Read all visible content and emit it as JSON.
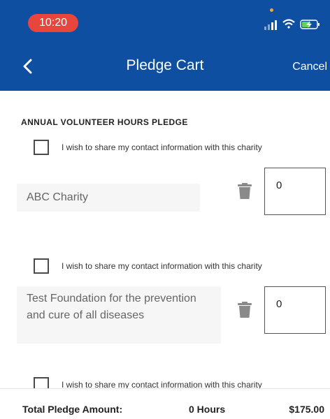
{
  "status_bar": {
    "time": "10:20",
    "icons": [
      "signal-icon",
      "wifi-icon",
      "battery-charging-icon"
    ]
  },
  "nav": {
    "back_icon": "chevron-left-icon",
    "title": "Pledge Cart",
    "cancel_label": "Cancel"
  },
  "section": {
    "title": "ANNUAL VOLUNTEER HOURS PLEDGE"
  },
  "items": [
    {
      "share_label": "I wish to share my contact information with this charity",
      "charity_name": "ABC Charity",
      "hours": "0"
    },
    {
      "share_label": "I wish to share my contact information with this charity",
      "charity_name": "Test Foundation for the prevention and cure of all diseases",
      "hours": "0"
    },
    {
      "share_label": "I wish to share my contact information with this charity"
    }
  ],
  "footer": {
    "total_label": "Total Pledge Amount:",
    "total_hours": "0 Hours",
    "total_amount": "$175.00"
  },
  "colors": {
    "header": "#0f4fa1",
    "time_pill": "#e8463d",
    "trash": "#8a8a8a"
  }
}
